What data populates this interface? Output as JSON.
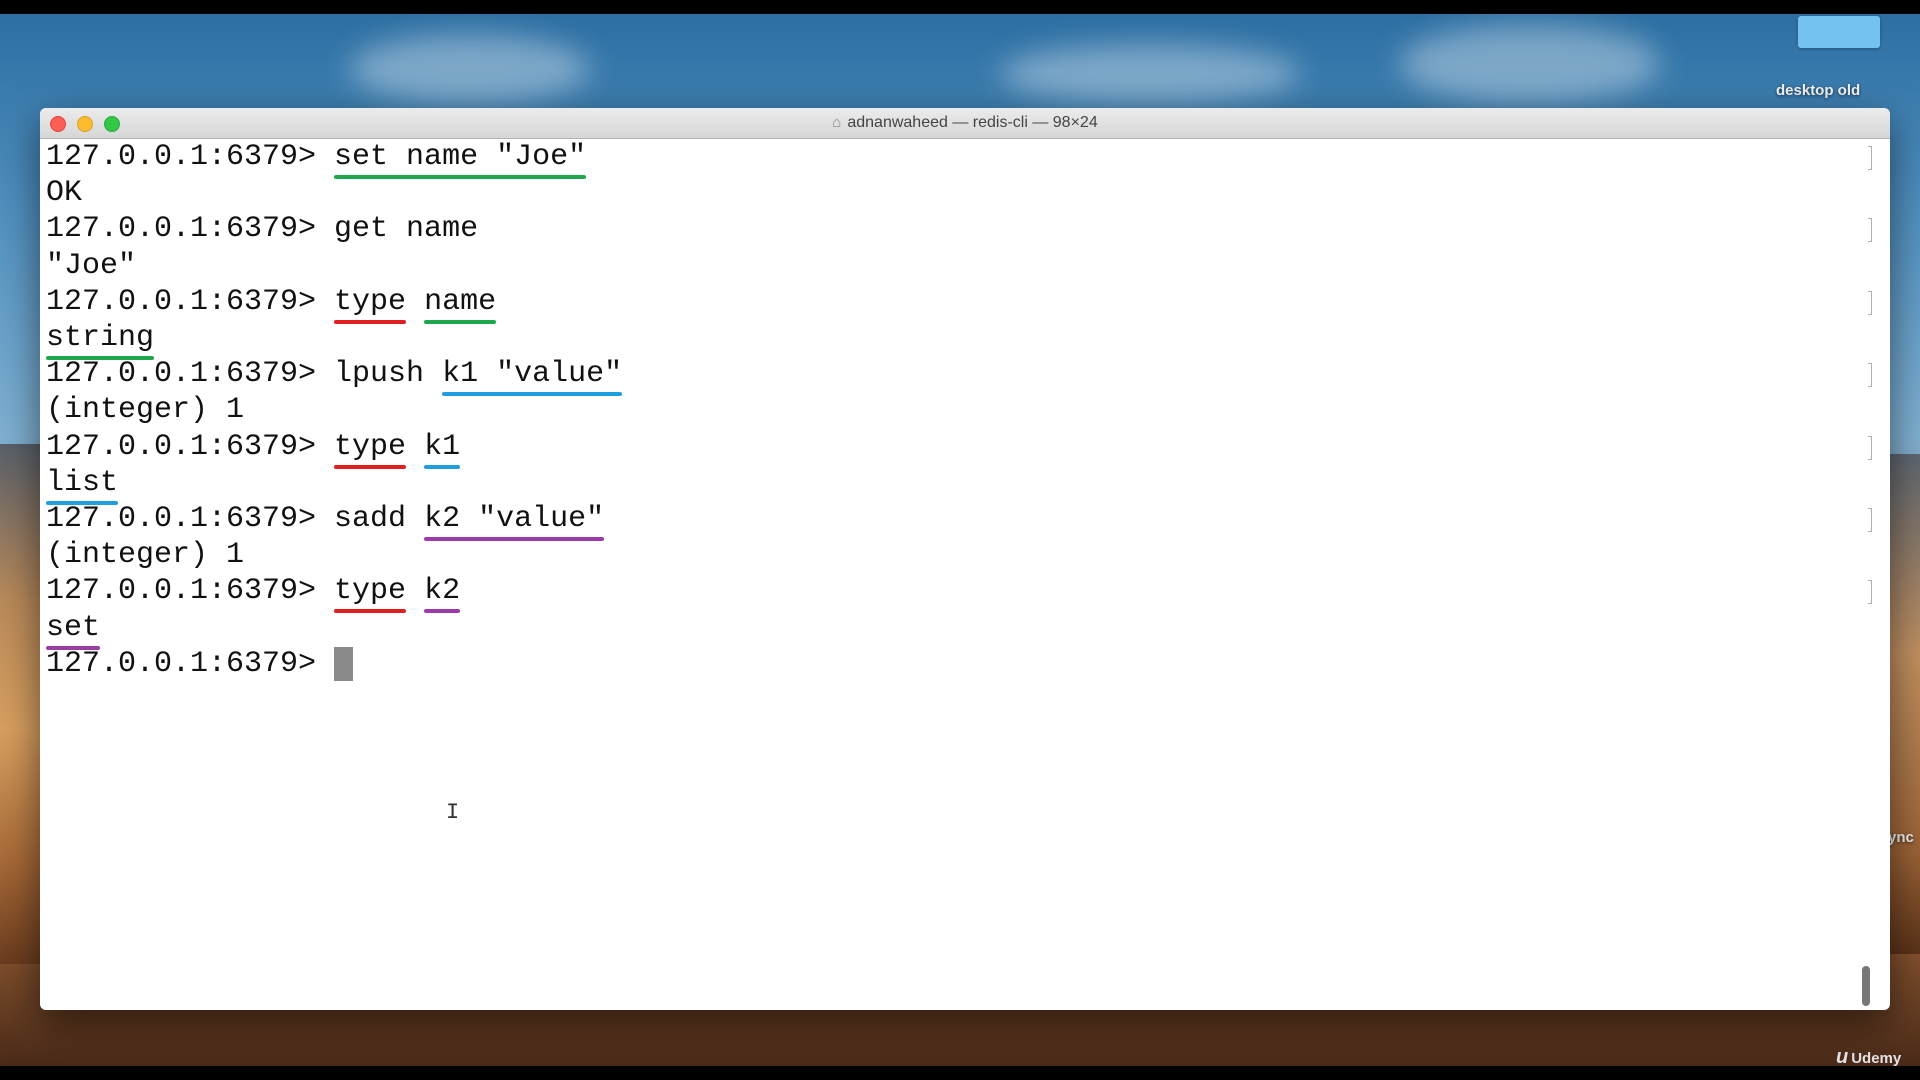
{
  "window": {
    "title": "adnanwaheed — redis-cli — 98×24",
    "title_icon": "home-folder-icon"
  },
  "desktop": {
    "folder_label": "desktop old",
    "partial_label": "ync",
    "watermark": "Udemy"
  },
  "terminal": {
    "prompt": "127.0.0.1:6379> ",
    "lines": [
      {
        "type": "cmd",
        "parts": [
          "set name \"Joe\""
        ]
      },
      {
        "type": "out",
        "parts": [
          "OK"
        ]
      },
      {
        "type": "cmd",
        "parts": [
          "get name"
        ]
      },
      {
        "type": "out",
        "parts": [
          "\"Joe\""
        ]
      },
      {
        "type": "cmd",
        "parts": [
          "type",
          " ",
          "name"
        ]
      },
      {
        "type": "out",
        "parts": [
          "string"
        ]
      },
      {
        "type": "cmd",
        "parts": [
          "lpush ",
          "k1 \"value\""
        ]
      },
      {
        "type": "out",
        "parts": [
          "(integer) 1"
        ]
      },
      {
        "type": "cmd",
        "parts": [
          "type",
          " ",
          "k1"
        ]
      },
      {
        "type": "out",
        "parts": [
          "list"
        ]
      },
      {
        "type": "cmd",
        "parts": [
          "sadd ",
          "k2 \"value\""
        ]
      },
      {
        "type": "out",
        "parts": [
          "(integer) 1"
        ]
      },
      {
        "type": "cmd",
        "parts": [
          "type",
          " ",
          "k2"
        ]
      },
      {
        "type": "out",
        "parts": [
          "set"
        ]
      },
      {
        "type": "cmd",
        "parts": [
          ""
        ]
      }
    ]
  },
  "annotation_colors": {
    "green": "#1fa84b",
    "red": "#e02020",
    "blue": "#1d9fe0",
    "purple": "#9b3ca8"
  }
}
